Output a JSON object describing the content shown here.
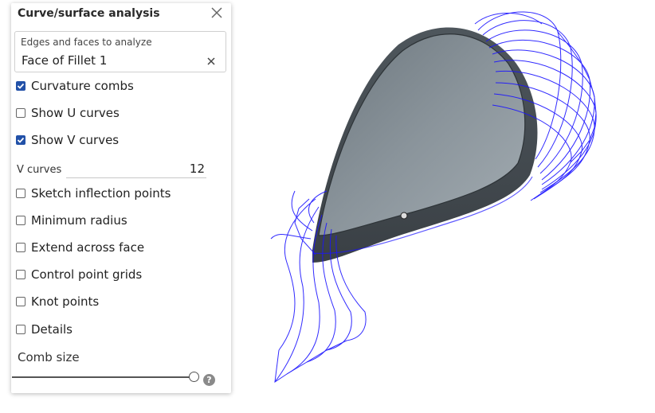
{
  "panel": {
    "title": "Curve/surface analysis",
    "selection": {
      "label": "Edges and faces to analyze",
      "value": "Face of Fillet 1"
    },
    "options": [
      {
        "label": "Curvature combs",
        "checked": true
      },
      {
        "label": "Show U curves",
        "checked": false
      },
      {
        "label": "Show V curves",
        "checked": true
      }
    ],
    "v_curves": {
      "label": "V curves",
      "value": "12"
    },
    "options2": [
      {
        "label": "Sketch inflection points",
        "checked": false
      },
      {
        "label": "Minimum radius",
        "checked": false
      },
      {
        "label": "Extend across face",
        "checked": false
      },
      {
        "label": "Control point grids",
        "checked": false
      },
      {
        "label": "Knot points",
        "checked": false
      },
      {
        "label": "Details",
        "checked": false
      }
    ],
    "comb_size": {
      "label": "Comb size",
      "level": 1.0
    },
    "help": "?"
  },
  "colors": {
    "accent": "#2251a8",
    "comb": "#1b14ff",
    "body": "#5f6870"
  }
}
